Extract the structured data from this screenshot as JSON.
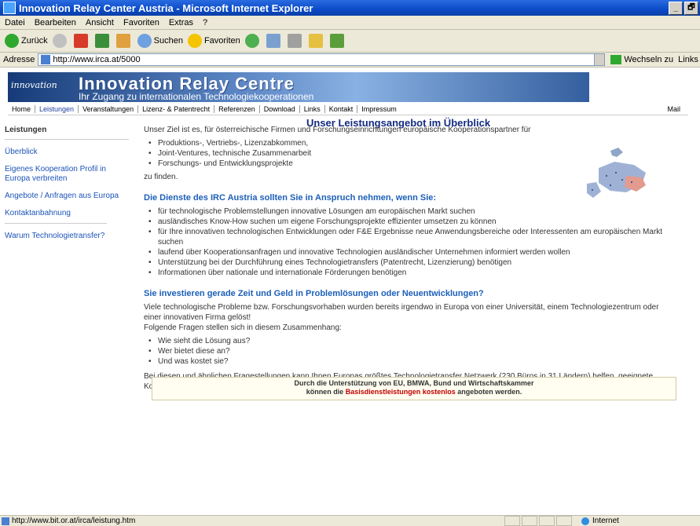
{
  "window": {
    "title": "Innovation Relay Center Austria - Microsoft Internet Explorer",
    "controls": [
      "_",
      "🗗"
    ]
  },
  "menu": [
    "Datei",
    "Bearbeiten",
    "Ansicht",
    "Favoriten",
    "Extras",
    "?"
  ],
  "toolbar": {
    "back": "Zurück",
    "search": "Suchen",
    "favorites": "Favoriten"
  },
  "address": {
    "label": "Adresse",
    "url": "http://www.irca.at/5000",
    "go": "Wechseln zu",
    "links": "Links"
  },
  "banner": {
    "logo": "innovation",
    "brand": "Innovation Relay Centre",
    "tagline": "Ihr Zugang zu internationalen Technologiekooperationen"
  },
  "nav": {
    "items": [
      "Home",
      "Leistungen",
      "Veranstaltungen",
      "Lizenz- & Patentrecht",
      "Referenzen",
      "Download",
      "Links",
      "Kontakt",
      "Impressum"
    ],
    "mail": "Mail"
  },
  "heading": "Unser Leistungsangebot im Überblick",
  "sidebar": {
    "title": "Leistungen",
    "links": [
      "Überblick",
      "Eigenes Kooperation Profil in Europa verbreiten",
      "Angebote / Anfragen aus Europa",
      "Kontaktanbahnung"
    ],
    "extra": "Warum Technologietransfer?"
  },
  "content": {
    "intro": "Unser Ziel ist es, für österreichische Firmen und Forschungseinrichtungen europäische Kooperationspartner für",
    "intro_list": [
      "Produktions-, Vertriebs-, Lizenzabkommen,",
      "Joint-Ventures, technische Zusammenarbeit",
      "Forschungs- und Entwicklungsprojekte"
    ],
    "intro_end": "zu finden.",
    "h1": "Die Dienste des IRC Austria sollten Sie in Anspruch nehmen, wenn Sie:",
    "services": [
      "für technologische Problemstellungen innovative Lösungen am europäischen Markt suchen",
      "ausländisches Know-How suchen um eigene Forschungsprojekte effizienter umsetzen zu können",
      "für Ihre innovativen technologischen Entwicklungen oder F&E Ergebnisse neue Anwendungsbereiche oder Interessenten am europäischen Markt suchen",
      "laufend über Kooperationsanfragen und innovative Technologien ausländischer Unternehmen informiert werden wollen",
      "Unterstützung bei der Durchführung eines Technologietransfers (Patentrecht, Lizenzierung) benötigen",
      "Informationen über nationale und internationale Förderungen benötigen"
    ],
    "h2": "Sie investieren gerade Zeit und Geld in Problemlösungen oder Neuentwicklungen?",
    "p2a": "Viele technologische Probleme bzw. Forschungsvorhaben wurden bereits irgendwo in Europa von einer Universität, einem Technologiezentrum oder einer innovativen Firma gelöst!",
    "p2b": "Folgende Fragen stellen sich in diesem Zusammenhang:",
    "questions": [
      "Wie sieht die Lösung aus?",
      "Wer bietet diese an?",
      "Und was kostet sie?"
    ],
    "p3": "Bei diesen und ähnlichen Fragestellungen kann Ihnen Europas größtes Technologietransfer Netzwerk (230 Büros in 31 Ländern) helfen, geeignete Kooperationspartner zu finden."
  },
  "notice": {
    "line1": "Durch die Unterstützung von EU, BMWA, Bund und Wirtschaftskammer",
    "line2_pre": "können die",
    "line2_red": "Basisdienstleistungen kostenlos",
    "line2_post": "angeboten werden."
  },
  "status": {
    "url": "http://www.bit.or.at/irca/leistung.htm",
    "zone": "Internet"
  }
}
